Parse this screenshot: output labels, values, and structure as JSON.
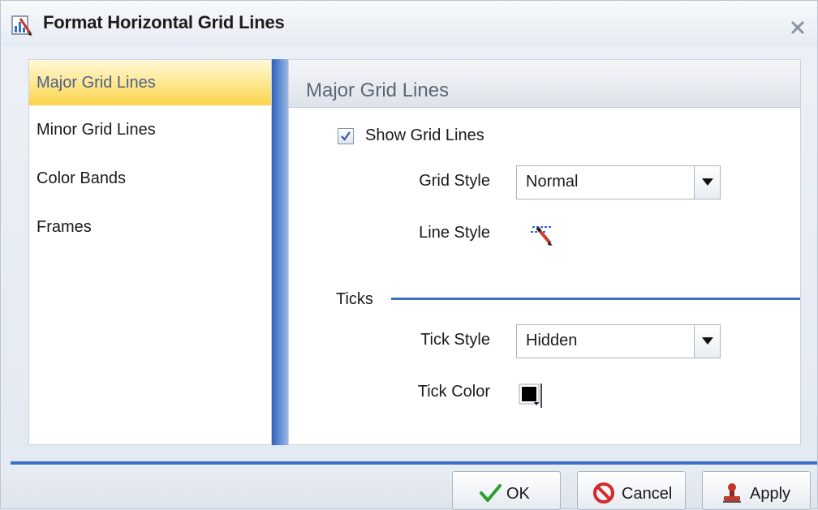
{
  "dialog": {
    "title": "Format Horizontal Grid Lines",
    "title_icon": "chart-format-icon",
    "close_icon": "close-icon"
  },
  "nav": {
    "items": [
      {
        "label": "Major Grid Lines",
        "selected": true
      },
      {
        "label": "Minor Grid Lines",
        "selected": false
      },
      {
        "label": "Color Bands",
        "selected": false
      },
      {
        "label": "Frames",
        "selected": false
      }
    ]
  },
  "panel": {
    "title": "Major Grid Lines",
    "show_grid_lines": {
      "label": "Show Grid Lines",
      "checked": true
    },
    "grid_style": {
      "label": "Grid Style",
      "value": "Normal"
    },
    "line_style": {
      "label": "Line Style",
      "icon": "line-style-pencil-icon"
    },
    "ticks": {
      "heading": "Ticks",
      "tick_style": {
        "label": "Tick Style",
        "value": "Hidden"
      },
      "tick_color": {
        "label": "Tick Color",
        "color": "#000000"
      }
    }
  },
  "footer": {
    "ok_label": "OK",
    "cancel_label": "Cancel",
    "apply_label": "Apply"
  },
  "colors": {
    "accent_blue": "#3b6fc4",
    "selection_yellow": "#fbd24a",
    "ok_green": "#2e9e2e",
    "cancel_red": "#d22a2a"
  }
}
